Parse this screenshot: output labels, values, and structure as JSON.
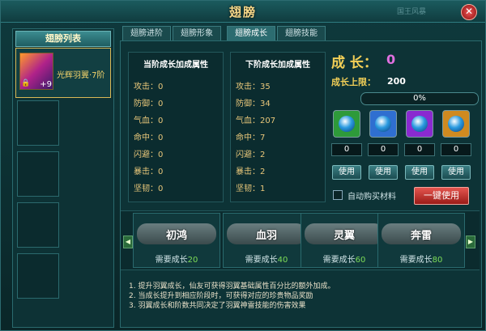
{
  "window": {
    "title": "翅膀",
    "topright_text": "国王风暴",
    "close_label": "✕"
  },
  "left": {
    "header": "翅膀列表",
    "items": [
      {
        "name": "光辉羽翼·7阶",
        "level": "+9",
        "lock": "🔒"
      }
    ]
  },
  "tabs": [
    "翅膀进阶",
    "翅膀形象",
    "翅膀成长",
    "翅膀技能"
  ],
  "current_stats": {
    "title": "当阶成长加成属性",
    "rows": [
      {
        "label": "攻击：",
        "value": "0"
      },
      {
        "label": "防御：",
        "value": "0"
      },
      {
        "label": "气血：",
        "value": "0"
      },
      {
        "label": "命中：",
        "value": "0"
      },
      {
        "label": "闪避：",
        "value": "0"
      },
      {
        "label": "暴击：",
        "value": "0"
      },
      {
        "label": "坚韧：",
        "value": "0"
      }
    ]
  },
  "next_stats": {
    "title": "下阶成长加成属性",
    "rows": [
      {
        "label": "攻击：",
        "value": "35"
      },
      {
        "label": "防御：",
        "value": "34"
      },
      {
        "label": "气血：",
        "value": "207"
      },
      {
        "label": "命中：",
        "value": "7"
      },
      {
        "label": "闪避：",
        "value": "2"
      },
      {
        "label": "暴击：",
        "value": "2"
      },
      {
        "label": "坚韧：",
        "value": "1"
      }
    ]
  },
  "growth": {
    "label": "成 长：",
    "value": "0",
    "limit_label": "成长上限：",
    "limit_value": "200",
    "progress_text": "0%",
    "progress": 0
  },
  "items": [
    {
      "icon": "green-orb-icon",
      "count": "0",
      "use_label": "使用",
      "color": "#2e9a3a"
    },
    {
      "icon": "blue-orb-icon",
      "count": "0",
      "use_label": "使用",
      "color": "#2f6fd0"
    },
    {
      "icon": "purple-orb-icon",
      "count": "0",
      "use_label": "使用",
      "color": "#8a2ad0"
    },
    {
      "icon": "orange-orb-icon",
      "count": "0",
      "use_label": "使用",
      "color": "#d08a20"
    }
  ],
  "auto_buy_label": "自动购买材料",
  "one_click_label": "一键使用",
  "stages": [
    {
      "name": "初鸿",
      "req_label": "需要成长",
      "req_value": "20"
    },
    {
      "name": "血羽",
      "req_label": "需要成长",
      "req_value": "40"
    },
    {
      "name": "灵翼",
      "req_label": "需要成长",
      "req_value": "60"
    },
    {
      "name": "奔雷",
      "req_label": "需要成长",
      "req_value": "80"
    }
  ],
  "arrows": {
    "left": "◀",
    "right": "▶"
  },
  "notes": [
    "1. 提升羽翼成长，仙友可获得羽翼基础属性百分比的额外加成。",
    "2. 当成长提升到相应阶段时，可获得对应的珍贵物品奖励",
    "3. 羽翼成长和阶数共同决定了羽翼神雷技能的伤害效果"
  ]
}
